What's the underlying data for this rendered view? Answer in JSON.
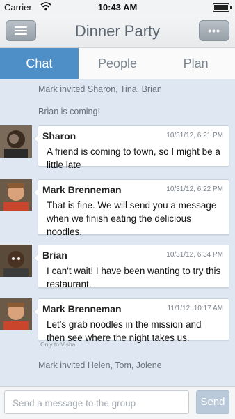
{
  "status_bar": {
    "carrier": "Carrier",
    "time": "10:43 AM"
  },
  "navbar": {
    "title": "Dinner Party"
  },
  "tabs": [
    {
      "label": "Chat"
    },
    {
      "label": "People"
    },
    {
      "label": "Plan"
    }
  ],
  "feed": {
    "system_messages": [
      "Mark invited Sharon, Tina, Brian",
      "Brian is coming!",
      "Mark invited Helen, Tom, Jolene"
    ],
    "messages": [
      {
        "sender": "Sharon",
        "timestamp": "10/31/12, 6:21 PM",
        "text": "A friend is coming to town, so I might be a little late"
      },
      {
        "sender": "Mark Brenneman",
        "timestamp": "10/31/12, 6:22 PM",
        "text": "That is fine. We will send you a message when we finish eating the delicious noodles."
      },
      {
        "sender": "Brian",
        "timestamp": "10/31/12, 6:34 PM",
        "text": "I can't wait! I have been wanting to try this restaurant."
      },
      {
        "sender": "Mark Brenneman",
        "timestamp": "11/1/12, 10:17 AM",
        "text": "Let's grab noodles in the mission and then see where the night takes us.",
        "note": "Only to Vishal"
      }
    ]
  },
  "composer": {
    "placeholder": "Send a message to the group",
    "send_label": "Send"
  },
  "colors": {
    "accent": "#4f8fc8",
    "background": "#dfe8f2",
    "send_button": "#b9c9da"
  }
}
